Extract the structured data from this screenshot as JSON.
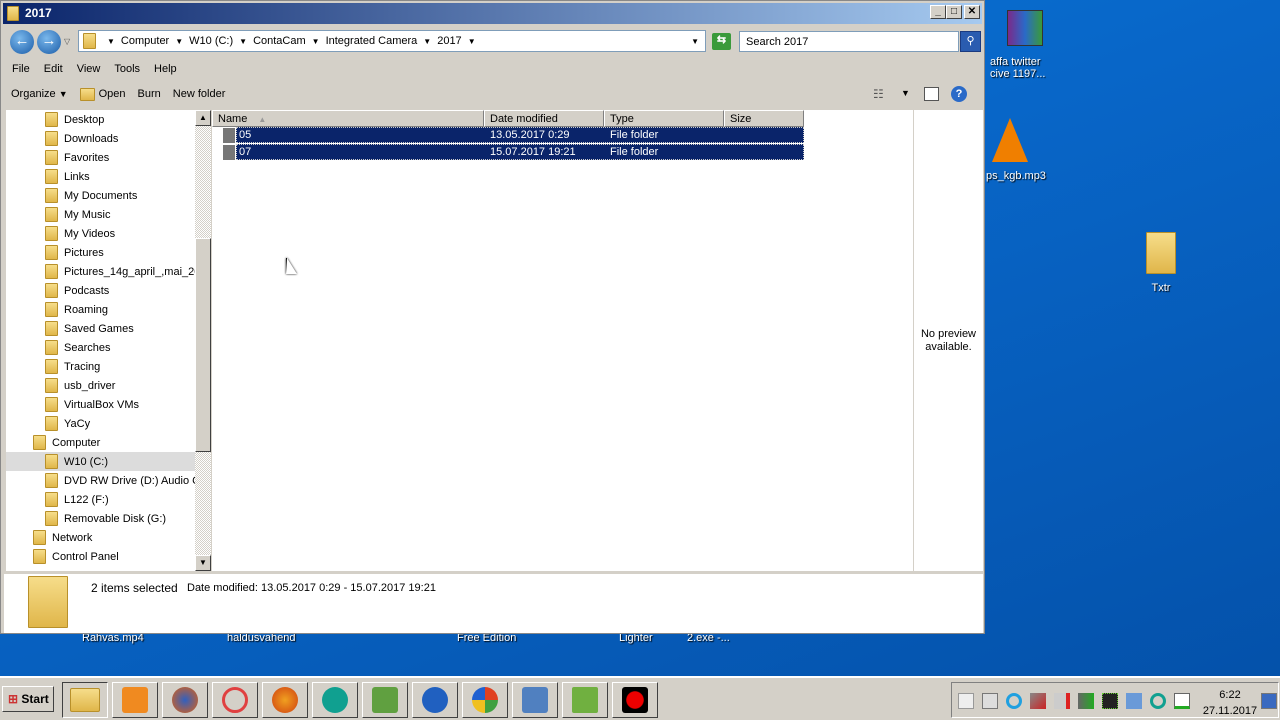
{
  "window": {
    "title": "2017"
  },
  "address": {
    "crumbs": [
      "Computer",
      "W10 (C:)",
      "ContaCam",
      "Integrated Camera",
      "2017"
    ],
    "search_placeholder": "Search 2017"
  },
  "menu": [
    "File",
    "Edit",
    "View",
    "Tools",
    "Help"
  ],
  "toolbar": {
    "organize": "Organize",
    "open": "Open",
    "burn": "Burn",
    "new_folder": "New folder"
  },
  "nav": [
    {
      "label": "Desktop",
      "indent": 1
    },
    {
      "label": "Downloads",
      "indent": 1
    },
    {
      "label": "Favorites",
      "indent": 1
    },
    {
      "label": "Links",
      "indent": 1
    },
    {
      "label": "My Documents",
      "indent": 1
    },
    {
      "label": "My Music",
      "indent": 1
    },
    {
      "label": "My Videos",
      "indent": 1
    },
    {
      "label": "Pictures",
      "indent": 1
    },
    {
      "label": "Pictures_14g_april_,mai_20",
      "indent": 1
    },
    {
      "label": "Podcasts",
      "indent": 1
    },
    {
      "label": "Roaming",
      "indent": 1
    },
    {
      "label": "Saved Games",
      "indent": 1
    },
    {
      "label": "Searches",
      "indent": 1
    },
    {
      "label": "Tracing",
      "indent": 1
    },
    {
      "label": "usb_driver",
      "indent": 1
    },
    {
      "label": "VirtualBox VMs",
      "indent": 1
    },
    {
      "label": "YaCy",
      "indent": 1
    },
    {
      "label": "Computer",
      "indent": 0
    },
    {
      "label": "W10 (C:)",
      "indent": 1,
      "selected": true
    },
    {
      "label": "DVD RW Drive (D:) Audio C",
      "indent": 1
    },
    {
      "label": "L122 (F:)",
      "indent": 1
    },
    {
      "label": "Removable Disk (G:)",
      "indent": 1
    },
    {
      "label": "Network",
      "indent": 0
    },
    {
      "label": "Control Panel",
      "indent": 0
    }
  ],
  "columns": [
    "Name",
    "Date modified",
    "Type",
    "Size"
  ],
  "files": [
    {
      "name": "05",
      "date": "13.05.2017 0:29",
      "type": "File folder",
      "size": ""
    },
    {
      "name": "07",
      "date": "15.07.2017 19:21",
      "type": "File folder",
      "size": ""
    }
  ],
  "preview": {
    "text": "No preview available."
  },
  "details": {
    "count": "2 items selected",
    "date_label": "Date modified:",
    "date_value": "13.05.2017 0:29 - 15.07.2017 19:21"
  },
  "desktop": {
    "icons": [
      "affa twitter",
      "cive 1197...",
      "ps_kgb.mp3",
      "Txtr"
    ],
    "behind": [
      "Rahvas.mp4",
      "haldusvahend",
      "Free Edition",
      "Lighter",
      "2.exe -..."
    ]
  },
  "taskbar": {
    "start": "Start",
    "time": "6:22",
    "date": "27.11.2017"
  }
}
